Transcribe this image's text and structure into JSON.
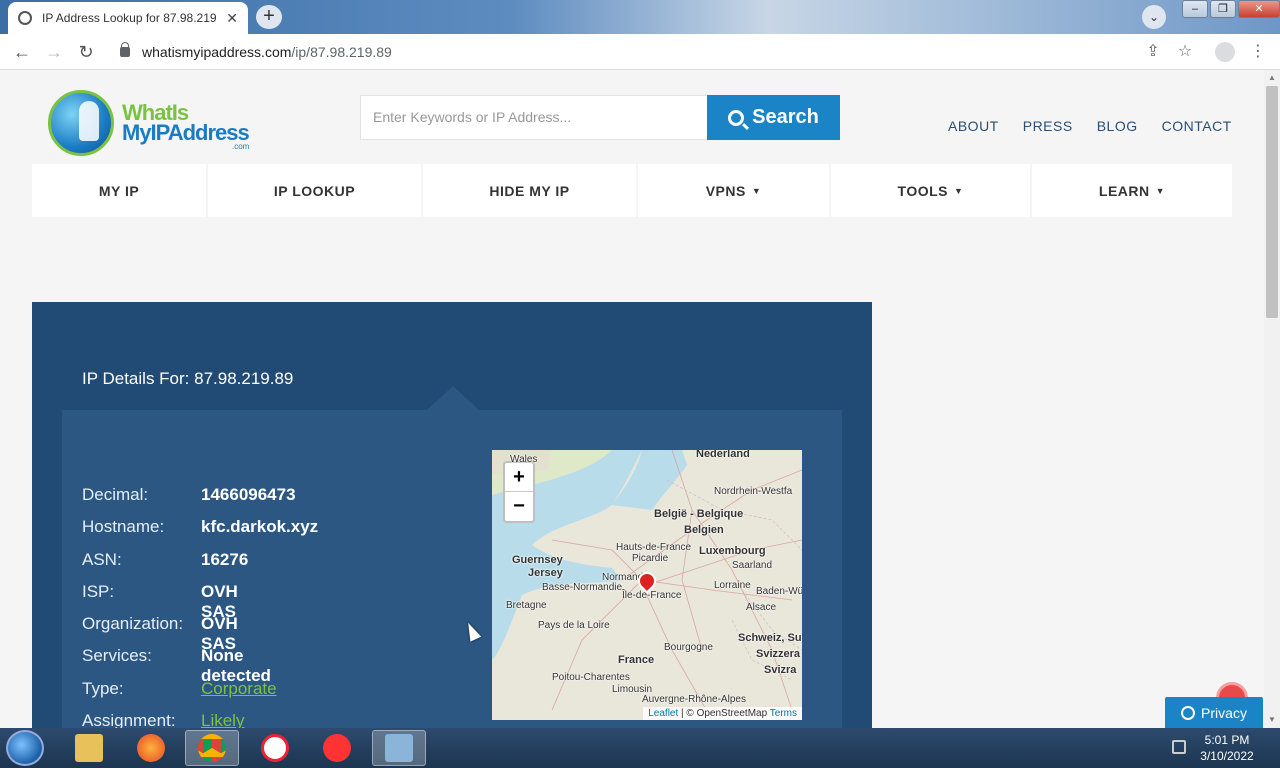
{
  "browser": {
    "tab_title": "IP Address Lookup for 87.98.219",
    "tab_close": "✕",
    "new_tab": "+",
    "url_domain": "whatismyipaddress.com",
    "url_path": "/ip/87.98.219.89"
  },
  "site": {
    "logo_line1": "WhatIs",
    "logo_line2": "MyIPAddress",
    "logo_line3": ".com",
    "search_placeholder": "Enter Keywords or IP Address...",
    "search_label": "Search",
    "top_links": [
      "ABOUT",
      "PRESS",
      "BLOG",
      "CONTACT"
    ],
    "nav": [
      {
        "label": "MY IP",
        "dropdown": false
      },
      {
        "label": "IP LOOKUP",
        "dropdown": false
      },
      {
        "label": "HIDE MY IP",
        "dropdown": false
      },
      {
        "label": "VPNS",
        "dropdown": true
      },
      {
        "label": "TOOLS",
        "dropdown": true
      },
      {
        "label": "LEARN",
        "dropdown": true
      }
    ]
  },
  "details": {
    "title": "IP Details For: 87.98.219.89",
    "rows": [
      {
        "label": "Decimal:",
        "value": "1466096473"
      },
      {
        "label": "Hostname:",
        "value": "kfc.darkok.xyz"
      },
      {
        "label": "ASN:",
        "value": "16276"
      },
      {
        "label": "ISP:",
        "value": "OVH SAS"
      },
      {
        "label": "Organization:",
        "value": "OVH SAS"
      },
      {
        "label": "Services:",
        "value": "None detected"
      },
      {
        "label": "Type:",
        "value": "Corporate"
      },
      {
        "label": "Assignment:",
        "value": "Likely Static IP"
      }
    ]
  },
  "map": {
    "zoom_in": "+",
    "zoom_out": "−",
    "labels": {
      "nederland": "Nederland",
      "nordrhein": "Nordrhein-Westfa",
      "belgie": "België - Belgique",
      "belgien": "Belgien",
      "hauts": "Hauts-de-France",
      "picardie": "Picardie",
      "luxembourg": "Luxembourg",
      "saarland": "Saarland",
      "guernsey": "Guernsey",
      "jersey": "Jersey",
      "normandie": "Normandie",
      "basse": "Basse-Normandie",
      "ile": "Île-de-France",
      "lorraine": "Lorraine",
      "badenwu": "Baden-Wü",
      "bretagne": "Bretagne",
      "alsace": "Alsace",
      "paysloire": "Pays de la Loire",
      "schweiz": "Schweiz, Su",
      "bourgogne": "Bourgogne",
      "svizzera": "Svizzera",
      "france": "France",
      "svizra": "Svizra",
      "poitou": "Poitou-Charentes",
      "limousin": "Limousin",
      "auvergne": "Auvergne-Rhône-Alpes",
      "wales": "Wales"
    },
    "attrib_leaflet": "Leaflet",
    "attrib_osm": " | © OpenStreetMap ",
    "attrib_terms": "Terms"
  },
  "privacy_label": "Privacy",
  "clock": {
    "time": "5:01 PM",
    "date": "3/10/2022"
  },
  "colors": {
    "panel": "#214a74",
    "inner": "#2c5783",
    "accent": "#1a84c6",
    "link_green": "#7cc242"
  }
}
